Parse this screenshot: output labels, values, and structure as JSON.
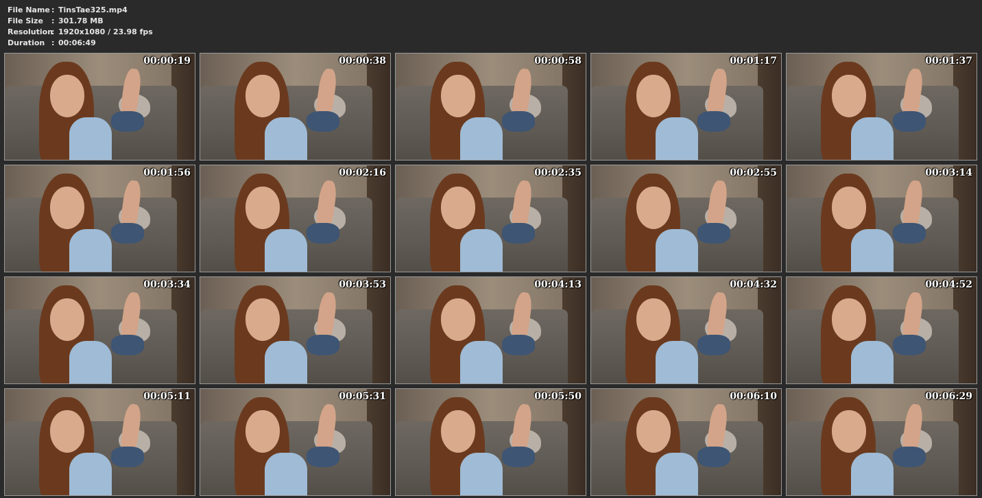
{
  "info": {
    "rows": [
      {
        "label": "File Name",
        "value": "TinsTae325.mp4"
      },
      {
        "label": "File Size",
        "value": "301.78 MB"
      },
      {
        "label": "Resolution",
        "value": "1920x1080 / 23.98 fps"
      },
      {
        "label": "Duration",
        "value": "00:06:49"
      }
    ],
    "separator": ":"
  },
  "thumbnails": [
    "00:00:19",
    "00:00:38",
    "00:00:58",
    "00:01:17",
    "00:01:37",
    "00:01:56",
    "00:02:16",
    "00:02:35",
    "00:02:55",
    "00:03:14",
    "00:03:34",
    "00:03:53",
    "00:04:13",
    "00:04:32",
    "00:04:52",
    "00:05:11",
    "00:05:31",
    "00:05:50",
    "00:06:10",
    "00:06:29"
  ],
  "colors": {
    "background": "#2a2a2a",
    "info_text": "#e6e6e6",
    "timestamp": "#ffffff"
  }
}
